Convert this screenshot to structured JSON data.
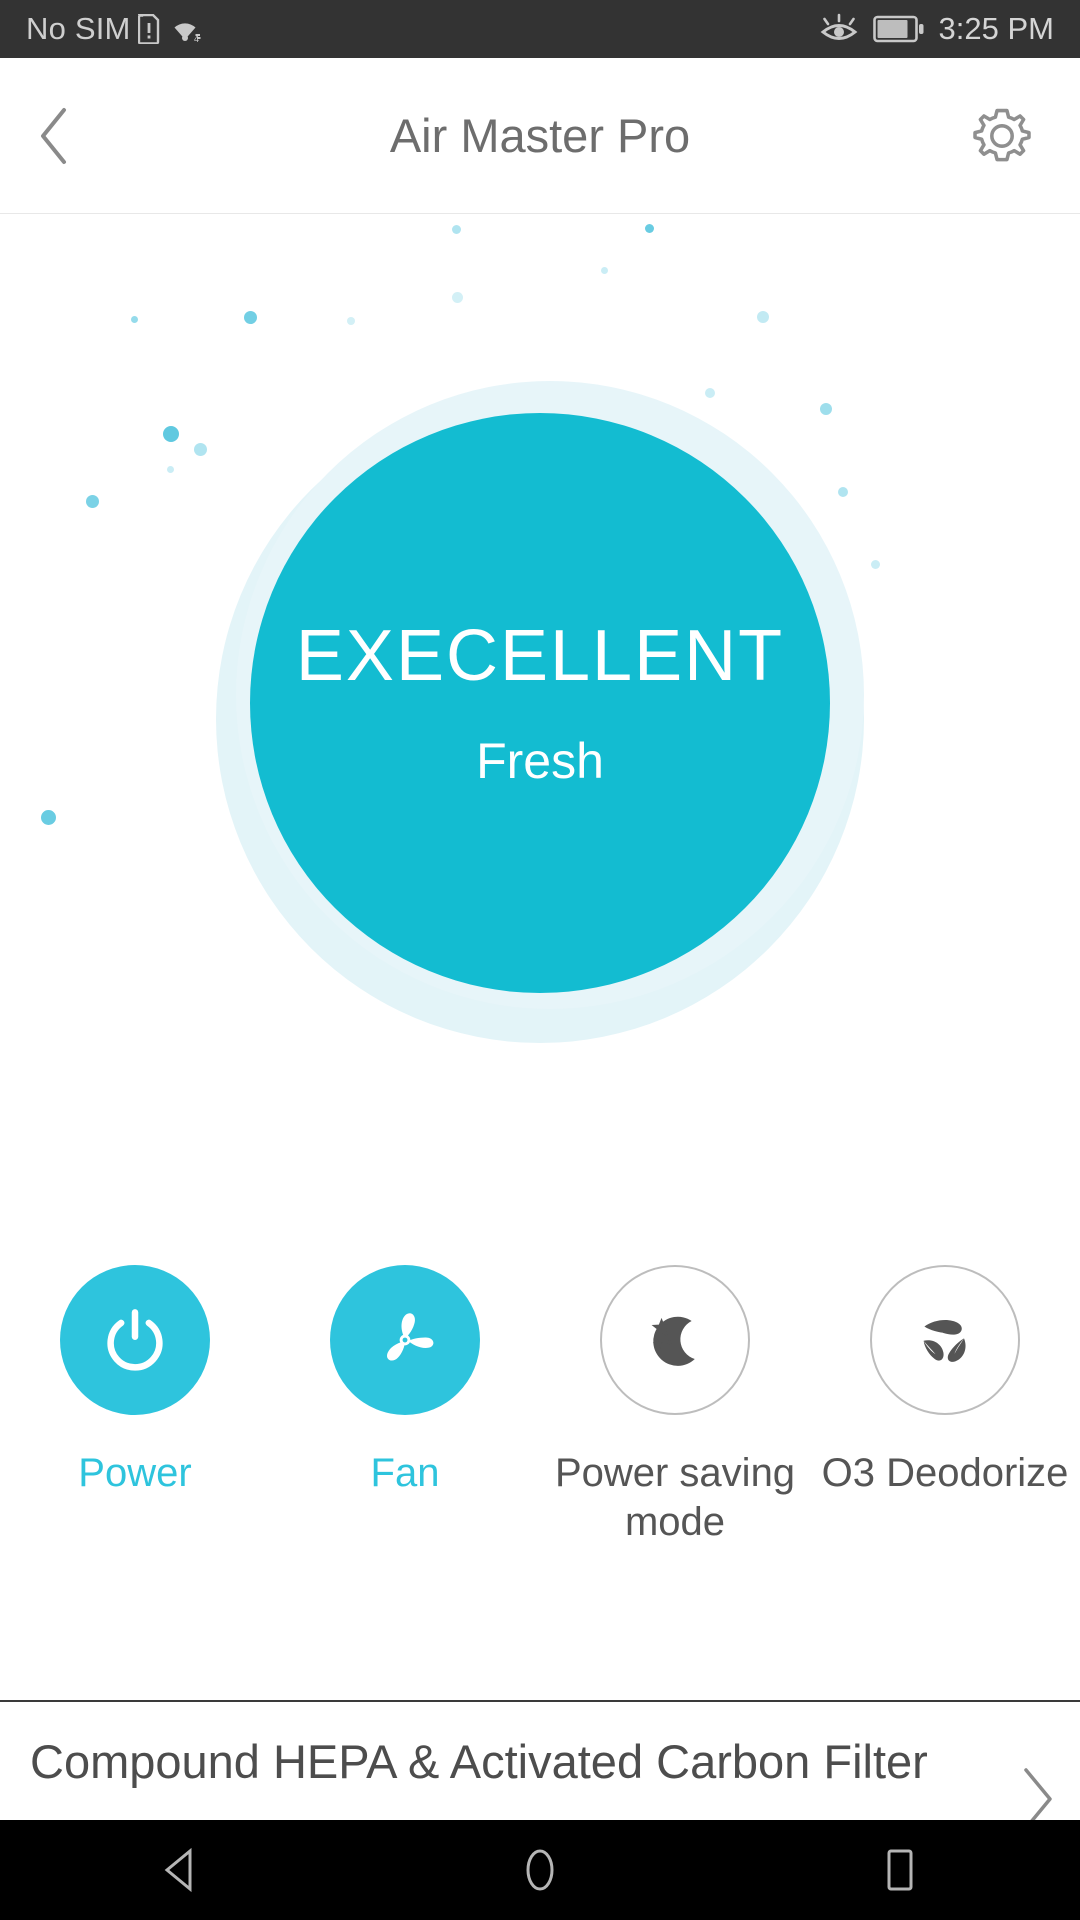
{
  "statusbar": {
    "carrier": "No SIM",
    "sim_icon": "sim-alert-icon",
    "wifi_icon": "wifi-icon",
    "eyecare_icon": "eye-care-icon",
    "battery_icon": "battery-icon",
    "time": "3:25 PM"
  },
  "header": {
    "back_icon": "chevron-left-icon",
    "title": "Air Master Pro",
    "settings_icon": "gear-icon"
  },
  "hero": {
    "level": "EXECELLENT",
    "sub": "Fresh",
    "circle_color": "#13bcd1",
    "halo_color": "#e3f4f8"
  },
  "controls": [
    {
      "label": "Power",
      "icon": "power-icon",
      "state": "active"
    },
    {
      "label": "Fan",
      "icon": "fan-icon",
      "state": "active"
    },
    {
      "label": "Power saving mode",
      "icon": "moon-stars-icon",
      "state": "inactive"
    },
    {
      "label": "O3 Deodorize",
      "icon": "leaves-icon",
      "state": "inactive"
    }
  ],
  "filter": {
    "label": "Compound HEPA & Activated Carbon Filter",
    "chevron_icon": "chevron-right-icon"
  },
  "navbar": {
    "back_icon": "nav-back-triangle-icon",
    "home_icon": "nav-home-circle-icon",
    "recents_icon": "nav-recents-square-icon"
  },
  "colors": {
    "accent": "#2ec4dd",
    "circle": "#13bcd1",
    "inactive_text": "#555555"
  }
}
